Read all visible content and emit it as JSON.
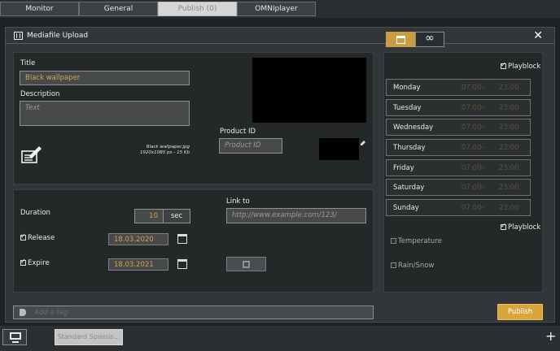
{
  "tabs": [
    {
      "label": "Monitor"
    },
    {
      "label": "General"
    },
    {
      "label": "Publish (0)"
    },
    {
      "label": "OMNIplayer"
    }
  ],
  "modal": {
    "title": "Mediafile Upload",
    "close_label": "✕"
  },
  "media": {
    "title_label": "Title",
    "title_value": "Black wallpaper",
    "description_label": "Description",
    "description_placeholder": "Text",
    "file_name": "Black wallpaper.jpg",
    "file_info": "1920x1080 px - 15 Kb",
    "product_id_label": "Product ID",
    "product_id_placeholder": "Product ID"
  },
  "schedule": {
    "duration_label": "Duration",
    "duration_value": "10",
    "duration_unit": "sec",
    "release_label": "Release",
    "release_date": "18.03.2020",
    "expire_label": "Expire",
    "expire_date": "18.03.2021",
    "link_label": "Link to",
    "link_placeholder": "http://www.example.com/123/"
  },
  "playblock": {
    "top_label": "Playblock",
    "bottom_label": "Playblock",
    "separator": "–",
    "days": [
      {
        "name": "Monday",
        "start": "07:00",
        "end": "23:00"
      },
      {
        "name": "Tuesday",
        "start": "07:00",
        "end": "23:00"
      },
      {
        "name": "Wednesday",
        "start": "07:00",
        "end": "23:00"
      },
      {
        "name": "Thursday",
        "start": "07:00",
        "end": "23:00"
      },
      {
        "name": "Friday",
        "start": "07:00",
        "end": "23:00"
      },
      {
        "name": "Saturday",
        "start": "07:00",
        "end": "23:00"
      },
      {
        "name": "Sunday",
        "start": "07:00",
        "end": "23:00"
      }
    ],
    "temperature_label": "Temperature",
    "rain_label": "Rain/Snow"
  },
  "footer": {
    "tag_placeholder": "Add a tag",
    "publish_label": "Publish"
  },
  "taskbar": {
    "tab_label": "Standard Spielsis...",
    "add_label": "+"
  },
  "colors": {
    "accent": "#d9a63b",
    "field_text": "#c8a85a",
    "panel": "#252829"
  }
}
